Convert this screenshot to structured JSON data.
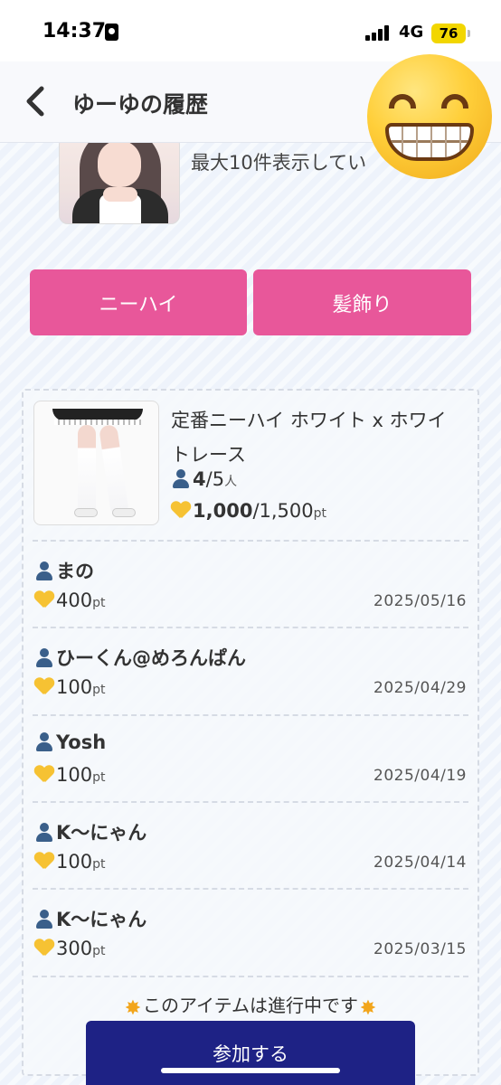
{
  "status_bar": {
    "time": "14:37",
    "network": "4G",
    "battery": "76"
  },
  "header": {
    "title": "ゆーゆの履歴"
  },
  "intro": {
    "text": "最大10件表示してい"
  },
  "categories": [
    {
      "label": "ニーハイ"
    },
    {
      "label": "髪飾り"
    }
  ],
  "item": {
    "title": "定番ニーハイ ホワイト x ホワイトレース",
    "participants_current": "4",
    "participants_total": "/5",
    "participants_unit": "人",
    "points_current": "1,000",
    "points_total": "/1,500",
    "points_unit": "pt"
  },
  "participants": [
    {
      "name": "まの",
      "points": "400",
      "unit": "pt",
      "date": "2025/05/16"
    },
    {
      "name": "ひーくん@めろんぱん",
      "points": "100",
      "unit": "pt",
      "date": "2025/04/29"
    },
    {
      "name": "Yosh",
      "points": "100",
      "unit": "pt",
      "date": "2025/04/19"
    },
    {
      "name": "K～にゃん",
      "points": "100",
      "unit": "pt",
      "date": "2025/04/14"
    },
    {
      "name": "K～にゃん",
      "points": "300",
      "unit": "pt",
      "date": "2025/03/15"
    }
  ],
  "notice": {
    "text": "このアイテムは進行中です"
  },
  "join_button": {
    "label": "参加する"
  }
}
